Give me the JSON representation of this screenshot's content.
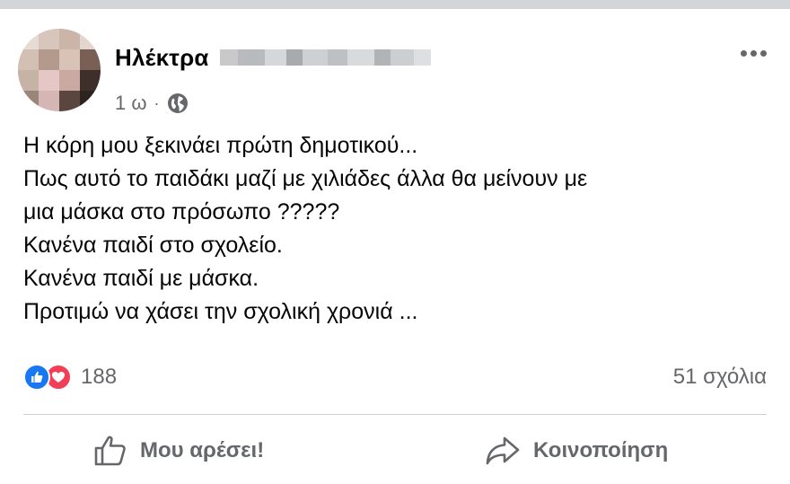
{
  "post": {
    "author_first_name": "Ηλέκτρα",
    "timestamp": "1 ω",
    "separator": "·",
    "audience_icon": "globe-icon",
    "more_icon": "more-options-icon",
    "text_lines": [
      "Η κόρη μου ξεκινάει πρώτη δημοτικού...",
      "Πως αυτό το παιδάκι μαζί με χιλιάδες άλλα θα μείνουν με",
      "μια μάσκα στο πρόσωπο ?????",
      "Κανένα παιδί στο σχολείο.",
      "Κανένα παιδί με μάσκα.",
      "Προτιμώ να χάσει την σχολική χρονιά ..."
    ]
  },
  "engagement": {
    "reaction_icons": [
      "like-reaction-icon",
      "love-reaction-icon"
    ],
    "reaction_count": "188",
    "comments": "51 σχόλια"
  },
  "actions": {
    "like_label": "Μου αρέσει!",
    "share_label": "Κοινοποίηση"
  },
  "colors": {
    "like_blue": "#1877f2",
    "love_red": "#f33e58",
    "secondary_text": "#65676b",
    "primary_text": "#050505"
  }
}
